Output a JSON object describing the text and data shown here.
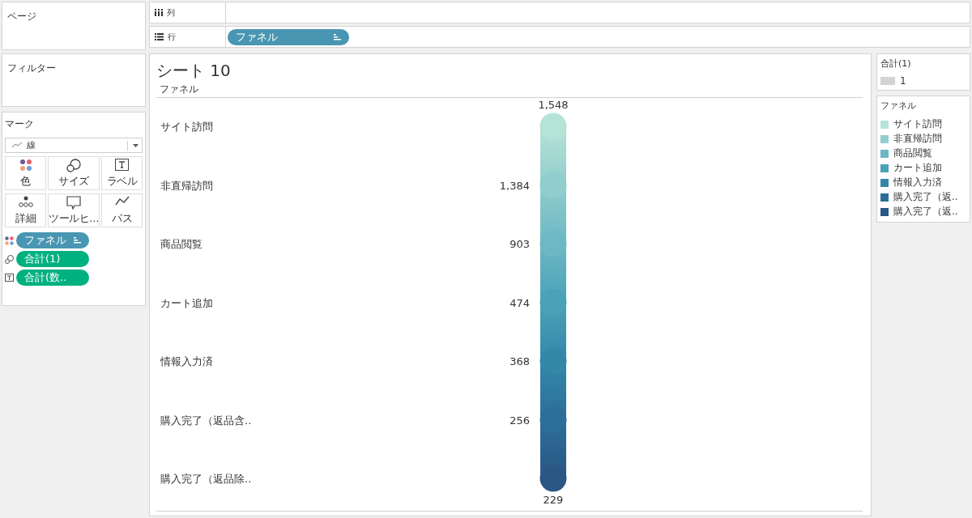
{
  "pages": {
    "title": "ページ"
  },
  "shelves": [
    {
      "kind": "columns",
      "label": "列"
    },
    {
      "kind": "rows",
      "label": "行",
      "pills": [
        {
          "text": "ファネル",
          "color": "#4996b2",
          "sorted": true
        }
      ]
    }
  ],
  "filters": {
    "title": "フィルター"
  },
  "marks": {
    "title": "マーク",
    "mark_type": "線",
    "buttons": [
      {
        "label": "色",
        "kind": "color"
      },
      {
        "label": "サイズ",
        "kind": "size"
      },
      {
        "label": "ラベル",
        "kind": "label"
      },
      {
        "label": "詳細",
        "kind": "detail"
      },
      {
        "label": "ツールヒ…",
        "kind": "tooltip"
      },
      {
        "label": "パス",
        "kind": "path"
      }
    ],
    "pills": [
      {
        "text": "ファネル",
        "kind": "color",
        "color": "#4996b2",
        "sorted": true
      },
      {
        "text": "合計(1)",
        "kind": "size",
        "color": "#00b180",
        "sorted": false
      },
      {
        "text": "合計(数..",
        "kind": "label",
        "color": "#00b180",
        "sorted": false
      }
    ]
  },
  "sheet": {
    "title": "シート 10",
    "header": "ファネル",
    "steps": [
      {
        "label": "サイト訪問",
        "value": "1,548"
      },
      {
        "label": "非直帰訪問",
        "value": "1,384"
      },
      {
        "label": "商品閲覧",
        "value": "903"
      },
      {
        "label": "カート追加",
        "value": "474"
      },
      {
        "label": "情報入力済",
        "value": "368"
      },
      {
        "label": "購入完了（返品含..",
        "value": "256"
      },
      {
        "label": "購入完了（返品除..",
        "value": "229"
      }
    ]
  },
  "size_legend": {
    "title": "合計(1)",
    "value": "1"
  },
  "color_legend": {
    "title": "ファネル",
    "items": [
      {
        "label": "サイト訪問",
        "color": "#b6e3d8"
      },
      {
        "label": "非直帰訪問",
        "color": "#91cdcc"
      },
      {
        "label": "商品閲覧",
        "color": "#6cb8c4"
      },
      {
        "label": "カート追加",
        "color": "#4aa2b8"
      },
      {
        "label": "情報入力済",
        "color": "#3388a8"
      },
      {
        "label": "購入完了（返..",
        "color": "#2c6e99"
      },
      {
        "label": "購入完了（返..",
        "color": "#2a5783"
      }
    ]
  }
}
